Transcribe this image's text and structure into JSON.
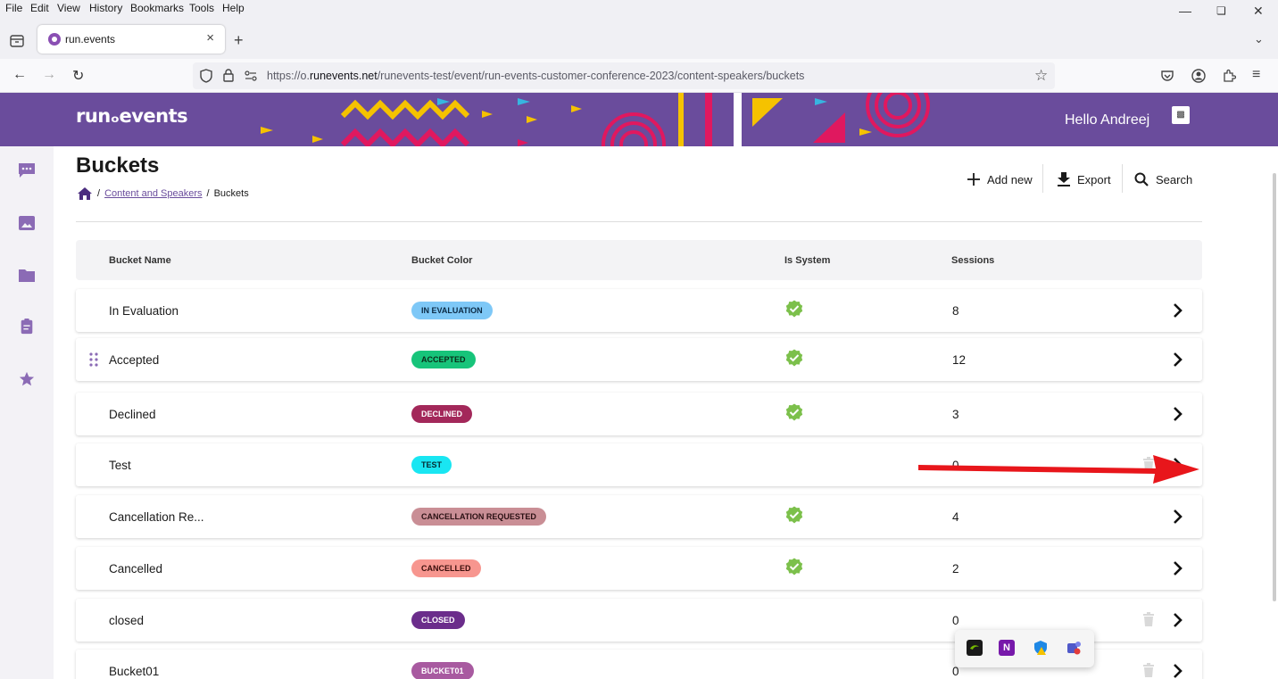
{
  "browser": {
    "menu": [
      "File",
      "Edit",
      "View",
      "History",
      "Bookmarks",
      "Tools",
      "Help"
    ],
    "tab_title": "run.events",
    "url_prefix": "https://o.",
    "url_host": "runevents.net",
    "url_path": "/runevents-test/event/run-events-customer-conference-2023/content-speakers/buckets"
  },
  "header": {
    "logo": "runₒevents",
    "greeting": "Hello Andreej"
  },
  "page": {
    "title": "Buckets",
    "breadcrumb": {
      "sep1": "/",
      "link": "Content and Speakers",
      "sep2": "/",
      "current": "Buckets"
    },
    "actions": {
      "add_new": "Add new",
      "export": "Export",
      "search": "Search"
    }
  },
  "table": {
    "columns": [
      "Bucket Name",
      "Bucket Color",
      "Is System",
      "Sessions"
    ],
    "rows": [
      {
        "name": "In Evaluation",
        "badge": "IN EVALUATION",
        "badge_bg": "#7ec8f7",
        "badge_fg": "#0b2a44",
        "is_system": true,
        "sessions": "8"
      },
      {
        "name": "Accepted",
        "badge": "ACCEPTED",
        "badge_bg": "#17c47a",
        "badge_fg": "#0a2a18",
        "is_system": true,
        "sessions": "12"
      },
      {
        "name": "Declined",
        "badge": "DECLINED",
        "badge_bg": "#a3285a",
        "badge_fg": "#ffffff",
        "is_system": true,
        "sessions": "3"
      },
      {
        "name": "Test",
        "badge": "TEST",
        "badge_bg": "#19e6f2",
        "badge_fg": "#062a30",
        "is_system": false,
        "sessions": "0"
      },
      {
        "name": "Cancellation Re...",
        "badge": "CANCELLATION REQUESTED",
        "badge_bg": "#c98e95",
        "badge_fg": "#2a1013",
        "is_system": true,
        "sessions": "4"
      },
      {
        "name": "Cancelled",
        "badge": "CANCELLED",
        "badge_bg": "#f7968f",
        "badge_fg": "#3a0e0b",
        "is_system": true,
        "sessions": "2"
      },
      {
        "name": "closed",
        "badge": "CLOSED",
        "badge_bg": "#6b2d8b",
        "badge_fg": "#ffffff",
        "is_system": false,
        "sessions": "0"
      },
      {
        "name": "Bucket01",
        "badge": "BUCKET01",
        "badge_bg": "#a85aa0",
        "badge_fg": "#ffffff",
        "is_system": false,
        "sessions": "0"
      }
    ]
  },
  "colors": {
    "brand": "#6a4c9c",
    "check": "#7cc04b",
    "annotation_arrow": "#e8161b"
  },
  "icons": {
    "sidebar": [
      "chat-icon",
      "image-icon",
      "folder-icon",
      "clipboard-icon",
      "star-icon"
    ],
    "tray": [
      "nvidia-icon",
      "onenote-icon",
      "defender-icon",
      "teams-icon"
    ]
  }
}
